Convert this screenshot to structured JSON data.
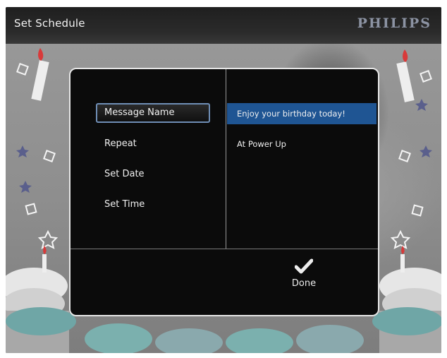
{
  "header": {
    "title": "Set Schedule",
    "brand": "PHILIPS"
  },
  "menu": {
    "items": [
      {
        "label": "Message Name",
        "selected": true
      },
      {
        "label": "Repeat",
        "selected": false
      },
      {
        "label": "Set Date",
        "selected": false
      },
      {
        "label": "Set Time",
        "selected": false
      }
    ]
  },
  "values": {
    "items": [
      {
        "label": "Enjoy your birthday today!",
        "highlighted": true
      },
      {
        "label": "At Power Up",
        "highlighted": false
      }
    ]
  },
  "actions": {
    "done_label": "Done",
    "done_icon": "checkmark-icon"
  },
  "colors": {
    "selection_border": "#6f8eb6",
    "highlight": "#1f5593",
    "dialog_bg": "#0b0b0b",
    "dialog_border": "#e6e6e6"
  }
}
